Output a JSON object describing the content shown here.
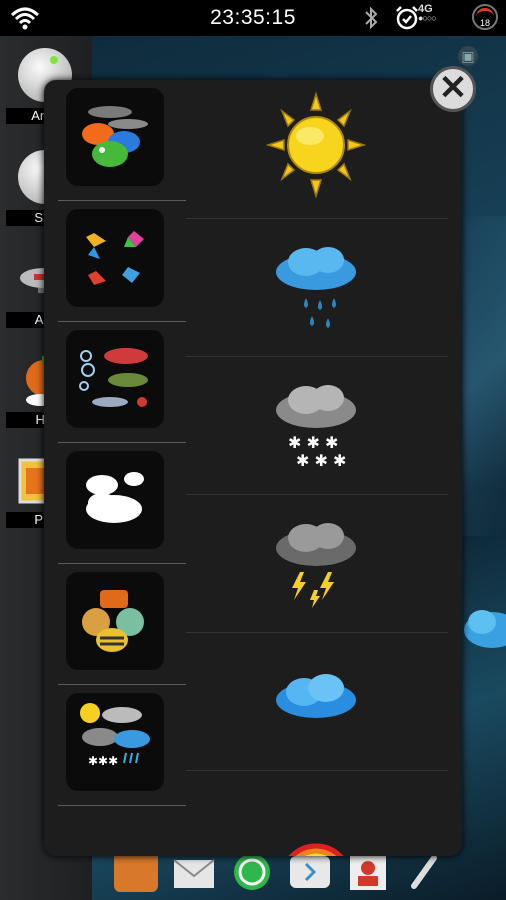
{
  "status_bar": {
    "time": "23:35:15",
    "network": "4G",
    "battery_level": "18",
    "icons": [
      "wifi-icon",
      "bluetooth-icon",
      "alarm-icon",
      "signal-icon",
      "battery-icon"
    ]
  },
  "sidebar": {
    "items": [
      {
        "label": "Anim",
        "icon": "animation-gear-icon"
      },
      {
        "label": "Sno",
        "icon": "snow-gear-icon"
      },
      {
        "label": "Airs",
        "icon": "airship-icon"
      },
      {
        "label": "Ha-",
        "icon": "halloween-icon"
      },
      {
        "label": "Pho",
        "icon": "photo-icon"
      }
    ]
  },
  "popup": {
    "close_label": "✕",
    "themes": [
      {
        "name": "fish-theme"
      },
      {
        "name": "pinwheel-theme"
      },
      {
        "name": "sea-creatures-theme"
      },
      {
        "name": "clouds-theme"
      },
      {
        "name": "animals-theme"
      },
      {
        "name": "weather-mix-theme"
      }
    ],
    "weather": [
      {
        "name": "sun"
      },
      {
        "name": "rain"
      },
      {
        "name": "snow"
      },
      {
        "name": "thunderstorm"
      },
      {
        "name": "cloud"
      },
      {
        "name": "rainbow"
      }
    ]
  },
  "dock": {
    "apps": [
      "gallery-icon",
      "email-icon",
      "whatsapp-icon",
      "messaging-icon",
      "contacts-icon",
      "phone-icon"
    ]
  },
  "colors": {
    "popup_bg": "#1d1d1d",
    "thumb_bg": "#0b0b0b",
    "status_bg": "#000000"
  }
}
